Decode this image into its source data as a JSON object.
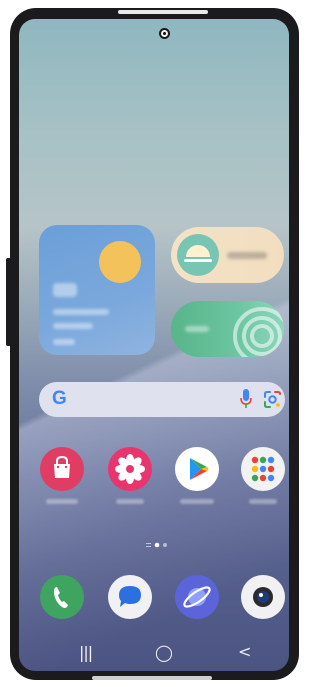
{
  "device": {
    "model_hint": "foldable phone"
  },
  "home_screen": {
    "widgets": {
      "weather": {
        "icon": "sun-icon"
      },
      "sunrise": {
        "icon": "sunrise-icon"
      },
      "health": {
        "icon": "activity-rings-icon"
      }
    },
    "search_bar": {
      "logo_text": "G",
      "icons": [
        "microphone-icon",
        "lens-icon"
      ]
    },
    "app_row_1": [
      {
        "id": "galaxy-store",
        "icon": "shopping-bag-icon",
        "color": "#e03d64"
      },
      {
        "id": "gallery",
        "icon": "flower-icon",
        "color": "#e9356e"
      },
      {
        "id": "play-store",
        "icon": "play-triangle-icon",
        "color": "#ffffff"
      },
      {
        "id": "google-folder",
        "icon": "app-folder-icon",
        "color": "#f2f2f2"
      }
    ],
    "page_indicator": {
      "pages": 2,
      "current": 1
    },
    "dock": [
      {
        "id": "phone",
        "icon": "phone-handset-icon",
        "color": "#3fa45f"
      },
      {
        "id": "messages",
        "icon": "message-bubble-icon",
        "color": "#f1f1f4"
      },
      {
        "id": "internet",
        "icon": "planet-icon",
        "color": "#5b65d9"
      },
      {
        "id": "camera",
        "icon": "camera-lens-icon",
        "color": "#f1f1f4"
      }
    ],
    "navigation_bar": {
      "recents_glyph": "|||",
      "home_glyph": "◯",
      "back_glyph": "<"
    }
  }
}
